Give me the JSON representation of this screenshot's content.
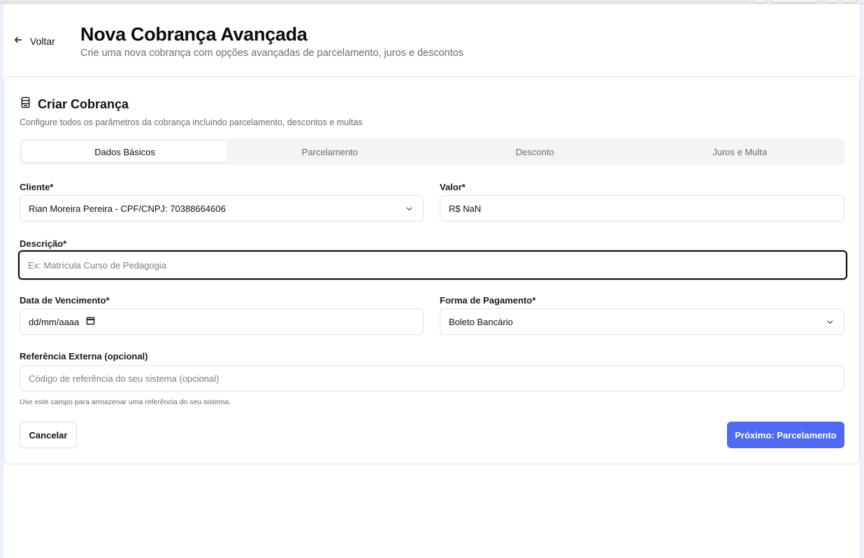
{
  "header": {
    "back_label": "Voltar",
    "title": "Nova Cobrança Avançada",
    "subtitle": "Crie uma nova cobrança com opções avançadas de parcelamento, juros e descontos"
  },
  "card": {
    "title": "Criar Cobrança",
    "description": "Configure todos os parâmetros da cobrança incluindo parcelamento, descontos e multas"
  },
  "tabs": [
    {
      "label": "Dados Básicos",
      "active": true
    },
    {
      "label": "Parcelamento",
      "active": false
    },
    {
      "label": "Desconto",
      "active": false
    },
    {
      "label": "Juros e Multa",
      "active": false
    }
  ],
  "form": {
    "cliente": {
      "label": "Cliente*",
      "value": "Rian Moreira Pereira - CPF/CNPJ: 70388664606"
    },
    "valor": {
      "label": "Valor*",
      "value": "R$ NaN"
    },
    "descricao": {
      "label": "Descrição*",
      "placeholder": "Ex: Matrícula Curso de Pedagogia"
    },
    "vencimento": {
      "label": "Data de Vencimento*",
      "value": "dd/mm/aaaa"
    },
    "pagamento": {
      "label": "Forma de Pagamento*",
      "value": "Boleto Bancário"
    },
    "referencia": {
      "label": "Referência Externa (opcional)",
      "placeholder": "Código de referência do seu sistema (opcional)",
      "hint": "Use este campo para armazenar uma referência do seu sistema."
    }
  },
  "actions": {
    "cancel_label": "Cancelar",
    "next_label": "Próximo: Parcelamento"
  },
  "icons": {
    "back": "arrow-left-icon",
    "card": "receipt-icon",
    "select": "chevron-down-icon",
    "calendar": "calendar-icon"
  },
  "colors": {
    "primary": "#4f6af0",
    "tabs_bg": "#f4f4f2"
  }
}
